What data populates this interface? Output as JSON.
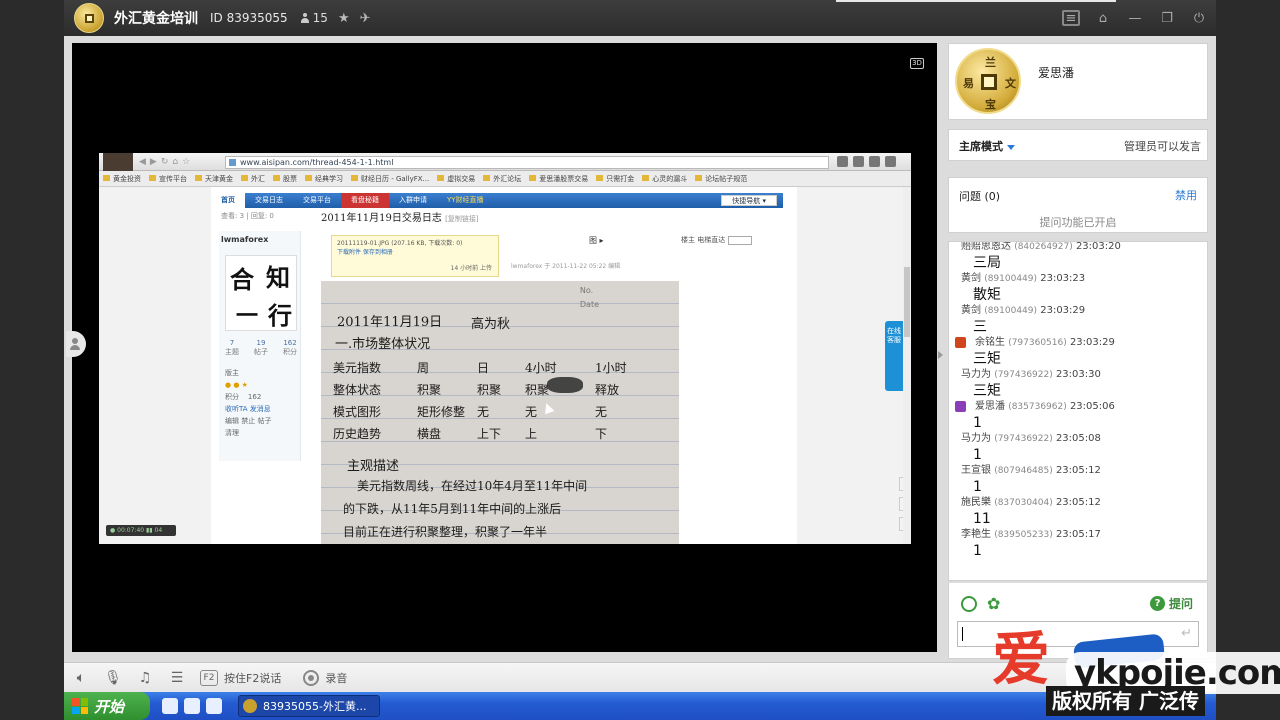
{
  "titlebar": {
    "channel_name": "外汇黄金培训",
    "channel_id": "ID 83935055",
    "viewers": "15"
  },
  "video": {
    "badge": "3D",
    "status": "● 00:07:40 ▮▮ 04"
  },
  "shared_screen": {
    "url": "www.aisipan.com/thread-454-1-1.html",
    "bookmarks": [
      "黄金投资",
      "宣传平台",
      "天津黄金",
      "外汇",
      "股票",
      "经典学习",
      "财经日历 - GallyFX...",
      "虚拟交易",
      "外汇论坛",
      "爱思潘股票交易",
      "只需打金",
      "心灵的漏斗",
      "论坛帖子规范"
    ],
    "nav_tabs": [
      "首页",
      "交易日志",
      "交易平台",
      "看盘秘籍",
      "入群申请",
      "YY财经直播"
    ],
    "quick_nav": "快捷导航 ▾",
    "stats": "查看: 3 | 回复: 0",
    "post_title": "2011年11月19日交易日志",
    "post_title_sub": "[复制链接]",
    "username": "lwmaforex",
    "profile_stats": [
      {
        "num": "7",
        "label": "主题"
      },
      {
        "num": "19",
        "label": "帖子"
      },
      {
        "num": "162",
        "label": "积分"
      }
    ],
    "profile_rank": "版主",
    "profile_points_label": "积分",
    "profile_points": "162",
    "profile_links": "收听TA  发消息",
    "profile_edit": "编辑 禁止 帖子",
    "profile_clean": "清理",
    "attachment": {
      "name": "20111119-01.JPG (207.16 KB, 下载次数: 0)",
      "links": "下载附件  保存到相册",
      "time": "14 小时前 上传"
    },
    "post_meta": "lwmaforex 于 2011-11-22 05:22 编辑",
    "meta_right": "楼主  电梯直达",
    "image_label": "图 ▸",
    "notebook": {
      "no_label": "No.",
      "date_label": "Date",
      "line_date": "2011年11月19日",
      "line_author": "高为秋",
      "line_title": "一.市场整体状况",
      "table_row1": [
        "美元指数",
        "周",
        "日",
        "4小时",
        "1小时"
      ],
      "table_row2": [
        "整体状态",
        "积聚",
        "积聚",
        "积聚",
        "释放"
      ],
      "table_row3": [
        "模式图形",
        "矩形修整",
        "无",
        "无",
        "无"
      ],
      "table_row4": [
        "历史趋势",
        "横盘",
        "上下",
        "上",
        "下"
      ],
      "section2": "主观描述",
      "para1": "美元指数周线，在经过10年4月至11年中间",
      "para2": "的下跌，从11年5月到11年中间的上涨后",
      "para3": "目前正在进行积聚整理，积聚了一年半"
    },
    "float_tab": "在线客服"
  },
  "panel": {
    "host_name": "爱思潘",
    "mode_label": "主席模式",
    "mode_right": "管理员可以发言",
    "qa_label": "问题 (0)",
    "qa_ban": "禁用",
    "qa_status": "提问功能已开启",
    "messages": [
      {
        "user": "贻赔思恩达",
        "id": "(840264927)",
        "time": "23:03:20",
        "text": "三局",
        "badge": ""
      },
      {
        "user": "黄剑",
        "id": "(89100449)",
        "time": "23:03:23",
        "text": "散矩",
        "badge": ""
      },
      {
        "user": "黄剑",
        "id": "(89100449)",
        "time": "23:03:29",
        "text": "三",
        "badge": ""
      },
      {
        "user": "余铭生",
        "id": "(797360516)",
        "time": "23:03:29",
        "text": "三矩",
        "badge": "#d0451b"
      },
      {
        "user": "马力为",
        "id": "(797436922)",
        "time": "23:03:30",
        "text": "三矩",
        "badge": ""
      },
      {
        "user": "爱思潘",
        "id": "(835736962)",
        "time": "23:05:06",
        "text": "1",
        "badge": "#8a3fb8"
      },
      {
        "user": "马力为",
        "id": "(797436922)",
        "time": "23:05:08",
        "text": "1",
        "badge": ""
      },
      {
        "user": "王宣银",
        "id": "(807946485)",
        "time": "23:05:12",
        "text": "1",
        "badge": ""
      },
      {
        "user": "施民樂",
        "id": "(837030404)",
        "time": "23:05:12",
        "text": "11",
        "badge": ""
      },
      {
        "user": "李艳生",
        "id": "(839505233)",
        "time": "23:05:17",
        "text": "1",
        "badge": ""
      }
    ],
    "ask_label": "提问"
  },
  "voicebar": {
    "f2_label": "F2",
    "ptt_label": "按住F2说话",
    "record_label": "录音"
  },
  "watermark": {
    "ai_char": "爱",
    "site": "ykpojie.com",
    "banner": "版权所有 广泛传"
  },
  "taskbar": {
    "start_label": "开始",
    "task_label": "83935055-外汇黄..."
  }
}
